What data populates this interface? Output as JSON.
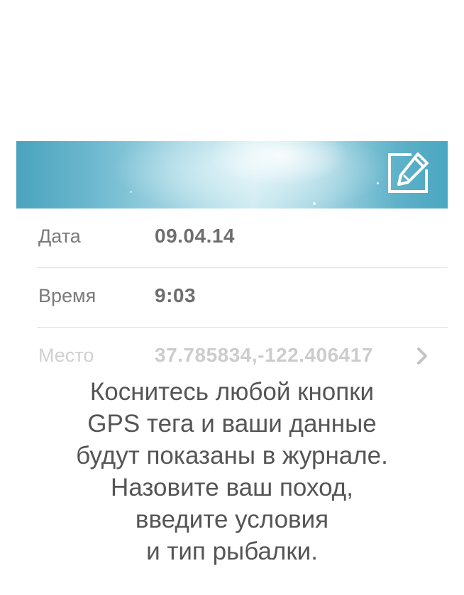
{
  "banner": {
    "edit_icon": "edit-pencil-icon",
    "colors": {
      "sky_dark": "#4aa3bd",
      "sky_light": "#cdeaf1"
    }
  },
  "details": {
    "rows": [
      {
        "label": "Дата",
        "value": "09.04.14"
      },
      {
        "label": "Время",
        "value": "9:03"
      },
      {
        "label": "Место",
        "value": "37.785834,-122.406417",
        "icon": "chevron-right-icon"
      }
    ]
  },
  "hint": {
    "lines": [
      "Коснитесь любой кнопки",
      "GPS тега и ваши данные",
      "будут показаны в журнале.",
      "Назовите ваш поход,",
      "введите условия",
      "и тип рыбалки."
    ]
  }
}
